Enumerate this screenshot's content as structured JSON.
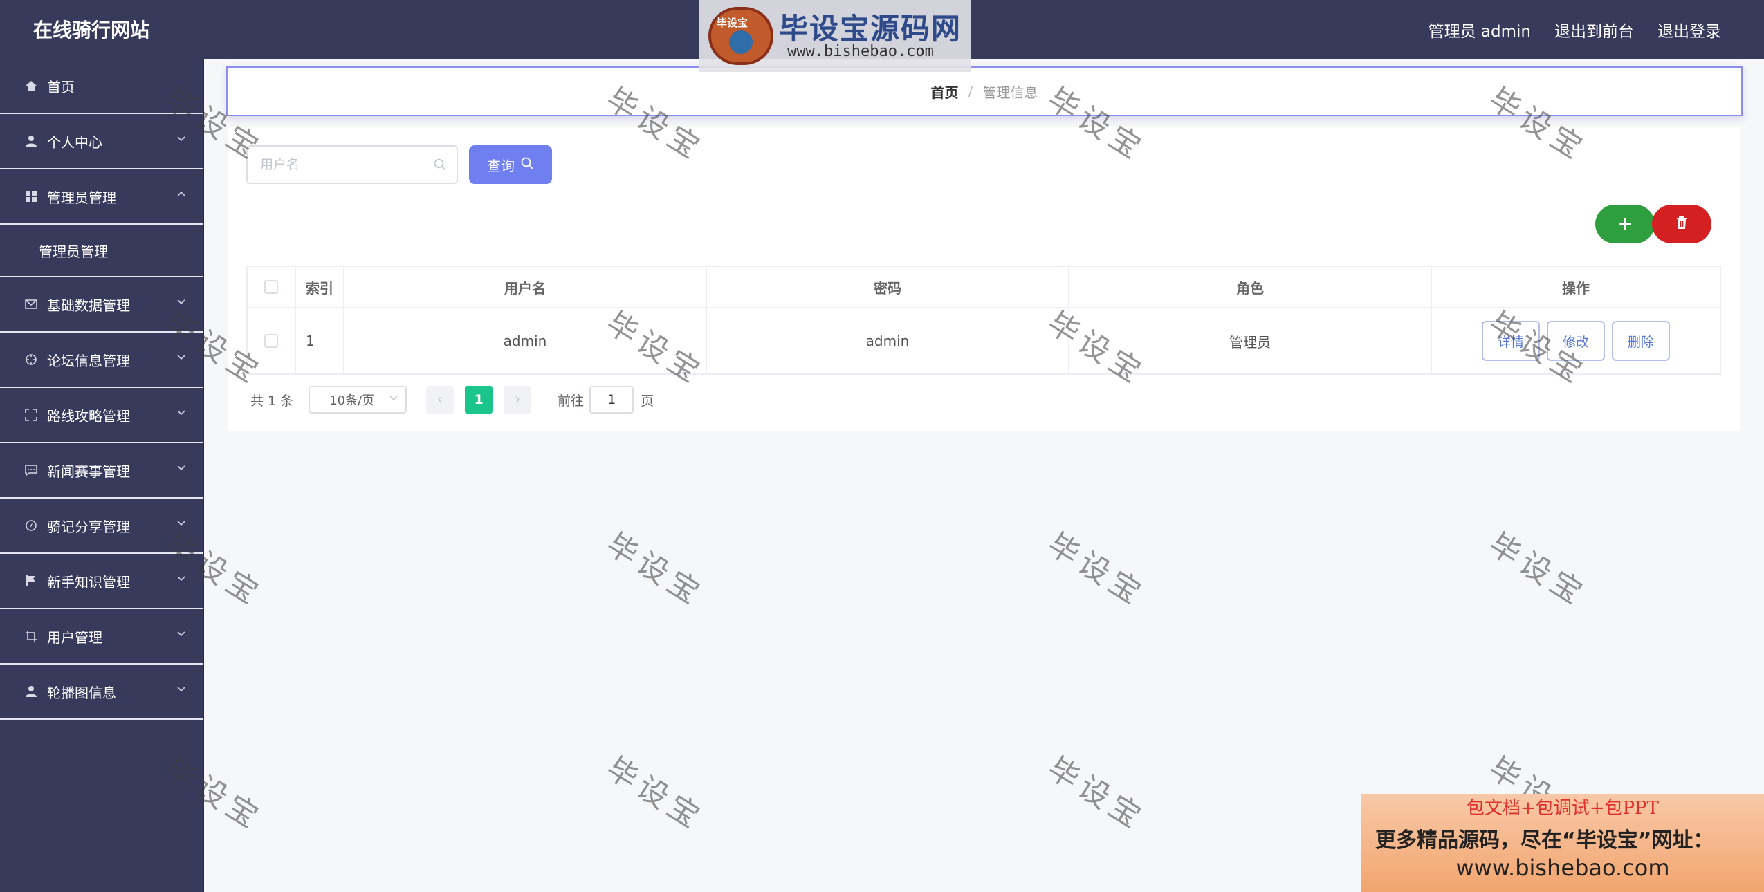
{
  "header": {
    "site_title": "在线骑行网站",
    "actions": [
      "管理员 admin",
      "退出到前台",
      "退出登录"
    ]
  },
  "logo_watermark": {
    "emblem_text": "毕设宝",
    "title": "毕设宝源码网",
    "url": "www.bishebao.com"
  },
  "sidebar": {
    "items": [
      {
        "label": "首页",
        "icon": "home-icon",
        "expandable": false
      },
      {
        "label": "个人中心",
        "icon": "user-icon",
        "expandable": true,
        "expanded": false
      },
      {
        "label": "管理员管理",
        "icon": "grid-icon",
        "expandable": true,
        "expanded": true,
        "children": [
          "管理员管理"
        ]
      },
      {
        "label": "基础数据管理",
        "icon": "mail-icon",
        "expandable": true,
        "expanded": false
      },
      {
        "label": "论坛信息管理",
        "icon": "crosshair-icon",
        "expandable": true,
        "expanded": false
      },
      {
        "label": "路线攻略管理",
        "icon": "fullscreen-icon",
        "expandable": true,
        "expanded": false
      },
      {
        "label": "新闻赛事管理",
        "icon": "chat-icon",
        "expandable": true,
        "expanded": false
      },
      {
        "label": "骑记分享管理",
        "icon": "compass-icon",
        "expandable": true,
        "expanded": false
      },
      {
        "label": "新手知识管理",
        "icon": "flag-icon",
        "expandable": true,
        "expanded": false
      },
      {
        "label": "用户管理",
        "icon": "crop-icon",
        "expandable": true,
        "expanded": false
      },
      {
        "label": "轮播图信息",
        "icon": "user-icon",
        "expandable": true,
        "expanded": false
      }
    ]
  },
  "breadcrumb": {
    "home": "首页",
    "separator": "/",
    "current": "管理信息"
  },
  "search": {
    "placeholder": "用户名",
    "value": "",
    "button_label": "查询"
  },
  "table": {
    "columns": [
      "索引",
      "用户名",
      "密码",
      "角色",
      "操作"
    ],
    "rows": [
      {
        "index": "1",
        "username": "admin",
        "password": "admin",
        "role": "管理员"
      }
    ],
    "row_actions": [
      "详情",
      "修改",
      "删除"
    ]
  },
  "pagination": {
    "total_text": "共 1 条",
    "page_size": "10条/页",
    "current_page": "1",
    "goto_label": "前往",
    "goto_value": "1",
    "goto_suffix": "页"
  },
  "watermark_text": "毕设宝",
  "ad": {
    "line1": "包文档+包调试+包PPT",
    "line2": "更多精品源码，尽在“毕设宝”网址：",
    "line3": "www.bishebao.com"
  },
  "colors": {
    "header_bg": "#383a5c",
    "sidebar_bg": "#383a5c",
    "query_button": "#6f7ff0",
    "add_button": "#2e9e3e",
    "delete_button": "#d42020",
    "current_page": "#1bc48a"
  }
}
